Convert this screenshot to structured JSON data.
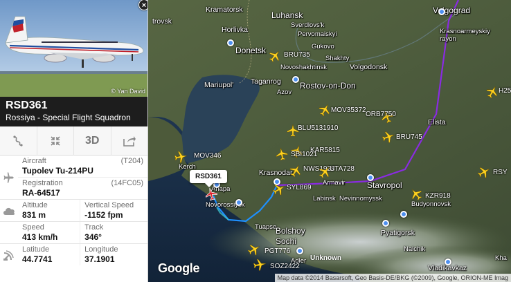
{
  "map": {
    "cities": [
      {
        "name": "Kramatorsk",
        "cls": ""
      },
      {
        "name": "Luhansk",
        "cls": "big"
      },
      {
        "name": "Volgograd",
        "cls": "big"
      },
      {
        "name": "trovsk",
        "cls": ""
      },
      {
        "name": "Horlivka",
        "cls": ""
      },
      {
        "name": "Donetsk",
        "cls": "big"
      },
      {
        "name": "Sverdlovs'k",
        "cls": "small"
      },
      {
        "name": "Gukovo",
        "cls": "small"
      },
      {
        "name": "Shakhty",
        "cls": "small"
      },
      {
        "name": "Novoshakhtinsk",
        "cls": "small"
      },
      {
        "name": "Pervomaiskyi",
        "cls": "small"
      },
      {
        "name": "Krasnoarmeyskiy rayon",
        "cls": "small"
      },
      {
        "name": "Mariupol'",
        "cls": ""
      },
      {
        "name": "Taganrog",
        "cls": ""
      },
      {
        "name": "Rostov-on-Don",
        "cls": "big"
      },
      {
        "name": "Volgodonsk",
        "cls": ""
      },
      {
        "name": "Elista",
        "cls": ""
      },
      {
        "name": "Krasnodar",
        "cls": ""
      },
      {
        "name": "Armavir",
        "cls": "small"
      },
      {
        "name": "Stavropol",
        "cls": "big"
      },
      {
        "name": "Labinsk",
        "cls": "small"
      },
      {
        "name": "Nevinnomyssk",
        "cls": "small"
      },
      {
        "name": "Budyonnovsk",
        "cls": "small"
      },
      {
        "name": "Kerch",
        "cls": "small"
      },
      {
        "name": "Anapa",
        "cls": "small"
      },
      {
        "name": "Novorossiysk",
        "cls": "small"
      },
      {
        "name": "Tuapse",
        "cls": "small"
      },
      {
        "name": "Bolshoy Sochi",
        "cls": "big"
      },
      {
        "name": "Pyatigorsk",
        "cls": ""
      },
      {
        "name": "Nalchik",
        "cls": "small"
      },
      {
        "name": "Vladikavkaz",
        "cls": ""
      },
      {
        "name": "Adler",
        "cls": "small"
      },
      {
        "name": "Kha",
        "cls": "small"
      },
      {
        "name": "Azov",
        "cls": "small"
      }
    ],
    "flights": [
      "BRU735",
      "MOV35372",
      "ORB7750",
      "BLU5131910",
      "BRU745",
      "KAR5815",
      "SBI1021",
      "NWS1928",
      "UTA728",
      "MOV346",
      "SYL869",
      "KZR918",
      "PGT776",
      "SOZ2422",
      "H25",
      "RSY"
    ],
    "selected_callout": "RSD361",
    "unknown_label": "Unknown",
    "google_logo": "Google",
    "attribution": "Map data ©2014 Basarsoft, Geo Basis-DE/BKG (©2009), Google, ORION-ME Imag",
    "route_color": "#8a2be2",
    "recent_track_color": "#1e90ff",
    "plane_color": "#ffd21f",
    "selected_plane_color": "#e0232b"
  },
  "panel": {
    "close_label": "×",
    "photo_credit": "© Yan David",
    "callsign": "RSD361",
    "airline": "Rossiya - Special Flight Squadron",
    "tools": {
      "route": "route-icon",
      "fit": "fit-view-icon",
      "view3d": "3D",
      "share": "share-icon"
    },
    "aircraft": {
      "label": "Aircraft",
      "code": "(T204)",
      "value": "Tupolev Tu-214PU"
    },
    "registration": {
      "label": "Registration",
      "code": "(14FC05)",
      "value": "RA-64517"
    },
    "altitude": {
      "label": "Altitude",
      "value": "831 m"
    },
    "vertical_speed": {
      "label": "Vertical Speed",
      "value": "-1152 fpm"
    },
    "speed": {
      "label": "Speed",
      "value": "413 km/h"
    },
    "track": {
      "label": "Track",
      "value": "346°"
    },
    "latitude": {
      "label": "Latitude",
      "value": "44.7741"
    },
    "longitude": {
      "label": "Longitude",
      "value": "37.1901"
    }
  }
}
